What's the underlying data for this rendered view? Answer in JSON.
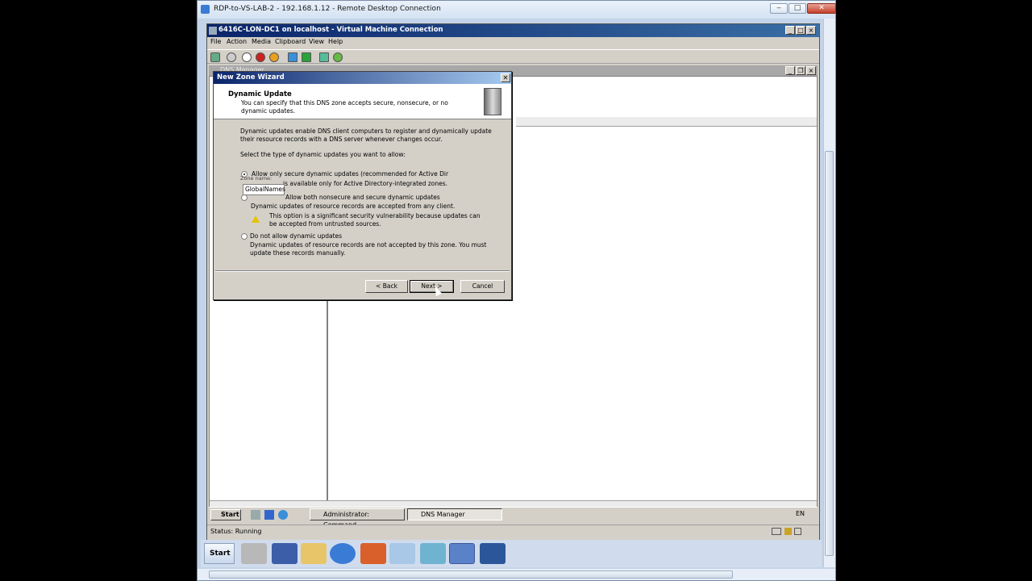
{
  "rdp": {
    "title": "RDP-to-VS-LAB-2 - 192.168.1.12 - Remote Desktop Connection",
    "min": "‒",
    "max": "□",
    "close": "✕"
  },
  "vm": {
    "title": "6416C-LON-DC1 on localhost - Virtual Machine Connection",
    "menu": [
      "File",
      "Action",
      "Media",
      "Clipboard",
      "View",
      "Help"
    ],
    "status": "Status: Running"
  },
  "dns": {
    "title": "DNS Manager"
  },
  "guest_taskbar": {
    "start": "Start",
    "tasks": [
      "Administrator: Command...",
      "DNS Manager"
    ],
    "lang": "EN"
  },
  "wizard": {
    "title": "New Zone Wizard",
    "close": "✕",
    "heading": "Dynamic Update",
    "subheading": "You can specify that this DNS zone accepts secure, nonsecure, or no dynamic updates.",
    "description": "Dynamic updates enable DNS client computers to register and dynamically update their resource records with a DNS server whenever changes occur.",
    "select_label": "Select the type of dynamic updates you want to allow:",
    "options": [
      {
        "label": "Allow only secure dynamic updates (recommended for Active Dir",
        "desc": "is available only for Active Directory-integrated zones.",
        "checked": true
      },
      {
        "label": "Allow both nonsecure and secure dynamic updates",
        "desc": "Dynamic updates of resource records are accepted from any client.",
        "checked": false
      },
      {
        "label": "Do not allow dynamic updates",
        "desc": "Dynamic updates of resource records are not accepted by this zone. You must update these records manually.",
        "checked": false
      }
    ],
    "zone_name_label": "Zone name:",
    "tooltip_value": "GlobalNames",
    "warning": "This option is a significant security vulnerability because updates can be accepted from untrusted sources.",
    "buttons": {
      "back": "< Back",
      "next": "Next >",
      "cancel": "Cancel"
    }
  },
  "host_taskbar": {
    "start": "Start"
  }
}
